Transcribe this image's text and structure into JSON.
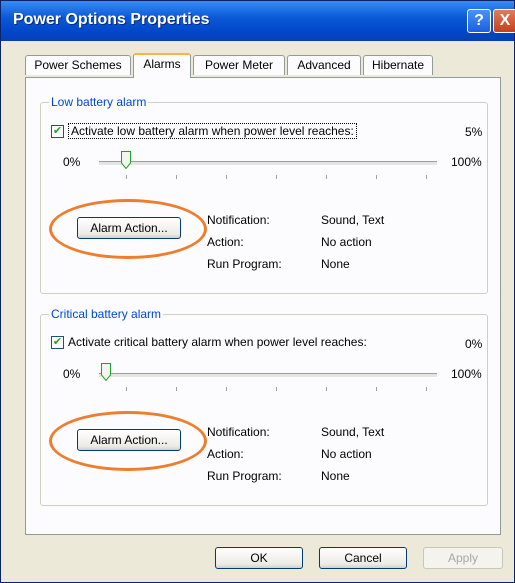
{
  "window": {
    "title": "Power Options Properties",
    "help_glyph": "?",
    "close_glyph": "X"
  },
  "tabs": [
    "Power Schemes",
    "Alarms",
    "Power Meter",
    "Advanced",
    "Hibernate"
  ],
  "low_battery": {
    "group_label": "Low battery alarm",
    "checkbox_label": "Activate low battery alarm when power level reaches:",
    "checked": true,
    "value": "5%",
    "slider_min": "0%",
    "slider_max": "100%",
    "slider_level_percent": 5,
    "alarm_button": "Alarm Action...",
    "info": {
      "notification_label": "Notification:",
      "notification_value": "Sound, Text",
      "action_label": "Action:",
      "action_value": "No action",
      "run_label": "Run Program:",
      "run_value": "None"
    }
  },
  "critical_battery": {
    "group_label": "Critical battery alarm",
    "checkbox_label": "Activate critical battery alarm when power level reaches:",
    "checked": true,
    "value": "0%",
    "slider_min": "0%",
    "slider_max": "100%",
    "slider_level_percent": 0,
    "alarm_button": "Alarm Action...",
    "info": {
      "notification_label": "Notification:",
      "notification_value": "Sound, Text",
      "action_label": "Action:",
      "action_value": "No action",
      "run_label": "Run Program:",
      "run_value": "None"
    }
  },
  "buttons": {
    "ok": "OK",
    "cancel": "Cancel",
    "apply": "Apply"
  },
  "annotation_color": "#ef7d2e"
}
